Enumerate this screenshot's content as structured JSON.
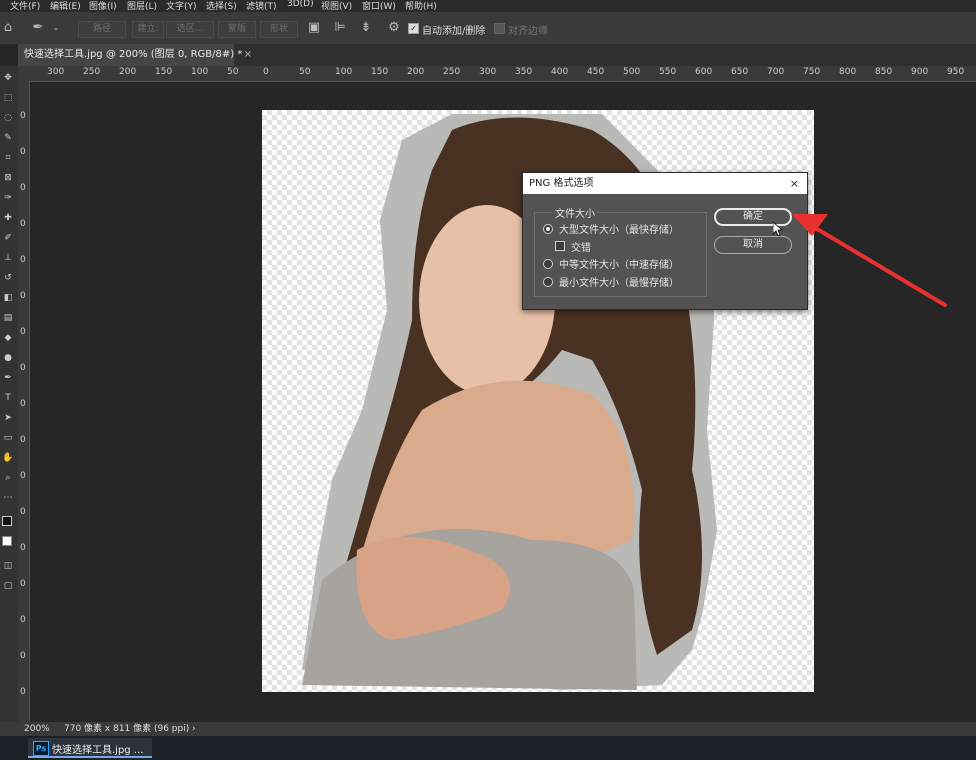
{
  "menu": [
    "文件(F)",
    "编辑(E)",
    "图像(I)",
    "图层(L)",
    "文字(Y)",
    "选择(S)",
    "滤镜(T)",
    "3D(D)",
    "视图(V)",
    "窗口(W)",
    "帮助(H)"
  ],
  "options": {
    "buttons": [
      "路径",
      "建立:",
      "选区...",
      "蒙版",
      "形状"
    ],
    "auto_add_delete": "自动添加/删除",
    "align_edges": "对齐边缘"
  },
  "tab": {
    "label": "快速选择工具.jpg @ 200% (图层 0, RGB/8#) *",
    "close": "×"
  },
  "ruler_top": [
    "300",
    "250",
    "200",
    "150",
    "100",
    "50",
    "0",
    "50",
    "100",
    "150",
    "200",
    "250",
    "300",
    "350",
    "400",
    "450",
    "500",
    "550",
    "600",
    "650",
    "700",
    "750",
    "800",
    "850",
    "900",
    "950"
  ],
  "ruler_left": [
    "0",
    "0",
    "0",
    "0",
    "0",
    "0",
    "0",
    "0",
    "0",
    "0",
    "0",
    "0",
    "0",
    "0",
    "0",
    "0",
    "0"
  ],
  "status": {
    "zoom": "200%",
    "info": "770 像素 x 811 像素 (96 ppi)",
    "arrow": "›"
  },
  "taskbar": {
    "app_icon": "Ps",
    "label": "快速选择工具.jpg ..."
  },
  "dialog": {
    "title": "PNG 格式选项",
    "close": "×",
    "group_label": "文件大小",
    "options": [
      {
        "label": "大型文件大小（最快存储）",
        "selected": true
      },
      {
        "label": "交错",
        "checked": false
      },
      {
        "label": "中等文件大小（中速存储）",
        "selected": false
      },
      {
        "label": "最小文件大小（最慢存储）",
        "selected": false
      }
    ],
    "ok": "确定",
    "cancel": "取消"
  },
  "colors": {
    "annotation_arrow": "#e8312f",
    "ui_bg": "#262626",
    "dialog_bg": "#535353"
  }
}
